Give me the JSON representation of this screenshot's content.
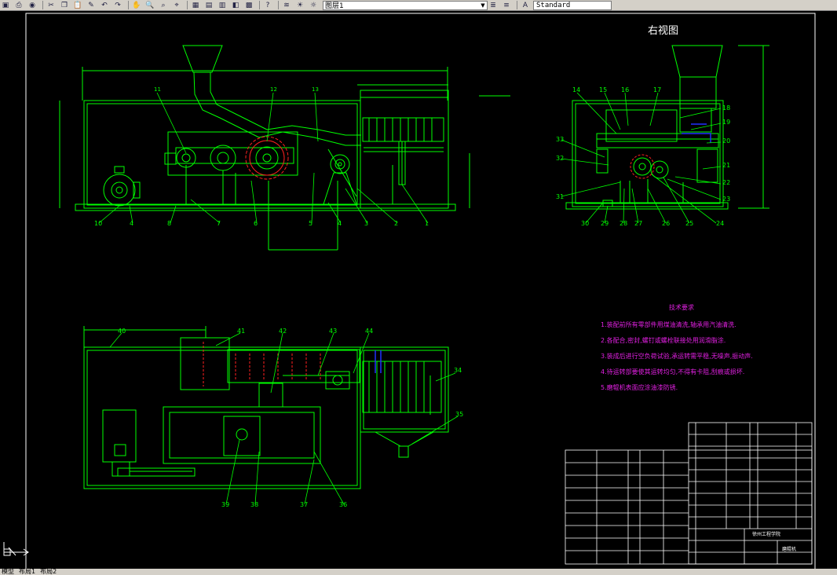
{
  "toolbar": {
    "layer_name": "图层1",
    "text_style": "Standard"
  },
  "drawing": {
    "view_title": "右视图",
    "front_balloons": [
      "11",
      "12",
      "13",
      "10",
      "4",
      "8",
      "7",
      "6",
      "5",
      "4",
      "3",
      "2",
      "1"
    ],
    "side_balloons": [
      "14",
      "15",
      "16",
      "17",
      "18",
      "19",
      "20",
      "21",
      "22",
      "23",
      "24",
      "25",
      "26",
      "27",
      "28",
      "29",
      "30",
      "31",
      "32",
      "33"
    ],
    "top_balloons": [
      "40",
      "41",
      "42",
      "43",
      "44",
      "34",
      "35",
      "39",
      "38",
      "37",
      "36"
    ],
    "requirements_title": "技术要求",
    "requirements": [
      "1.装配前所有零部件用煤油清洗,轴承用汽油清洗.",
      "2.各配合,密封,螺钉或螺栓联接处用润滑脂涂.",
      "3.装成后进行空负荷试验,承运转需平稳,无噪声,振动声.",
      "4.待运转部要使其运转均匀,不得有卡阻,刮痕或损坏.",
      "5.磨辊机表面应涂油漆防锈."
    ],
    "titleblock_school": "徐州工程学院",
    "titleblock_name": "磨辊机"
  },
  "tabs": [
    "模型",
    "布局1",
    "布局2"
  ],
  "colors": {
    "line": "#00ff00",
    "frame": "#ffffff",
    "text_magenta": "#e020e0",
    "blue_part": "#2030ff",
    "red_part": "#ff2020",
    "ucs": "#ffffff"
  }
}
